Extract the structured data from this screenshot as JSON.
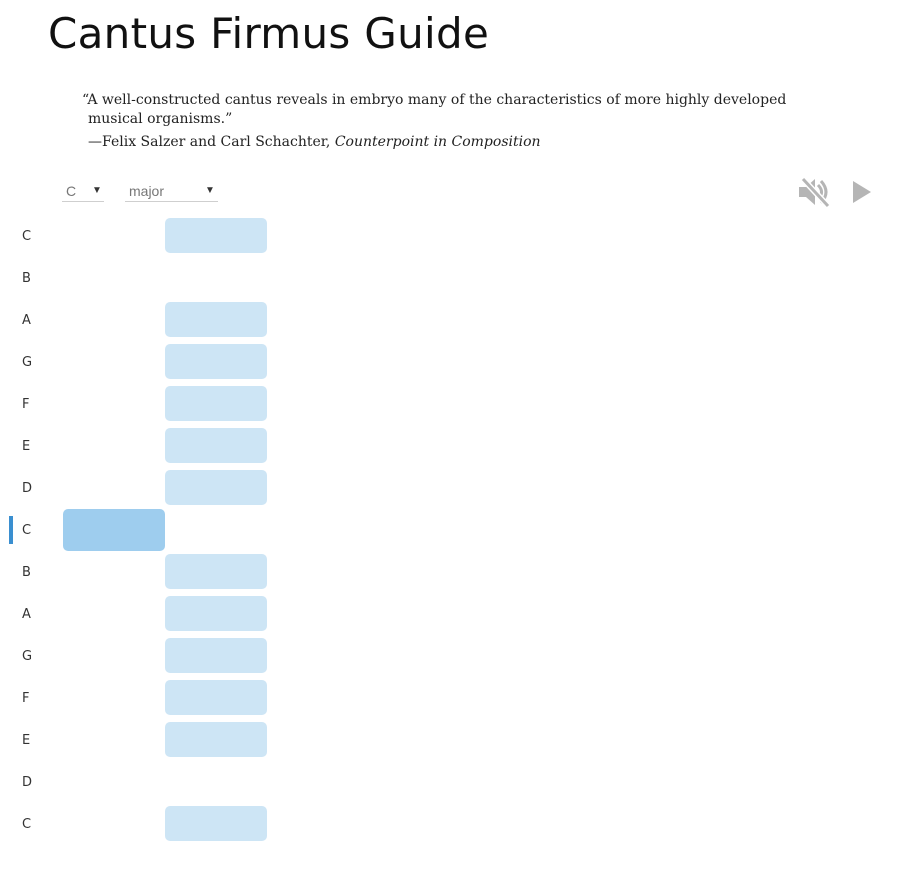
{
  "page": {
    "title": "Cantus Firmus Guide"
  },
  "quote": {
    "text": "“A well-constructed cantus reveals in embryo many of the characteristics of more highly developed musical organisms.”",
    "attribution_prefix": "—Felix Salzer and Carl Schachter, ",
    "attribution_work": "Counterpoint in Composition"
  },
  "controls": {
    "tonic": {
      "value": "C",
      "arrow": "▼"
    },
    "mode": {
      "value": "major",
      "arrow": "▼"
    },
    "mute_icon": "speaker-muted-icon",
    "play_icon": "play-icon",
    "icon_color": "#b5b5b5"
  },
  "colors": {
    "option_cell": "#cde5f5",
    "chosen_cell": "#9ecdee",
    "tonic_marker": "#3a8fd0"
  },
  "pitches": [
    {
      "label": "C",
      "option": true
    },
    {
      "label": "B",
      "option": false
    },
    {
      "label": "A",
      "option": true
    },
    {
      "label": "G",
      "option": true
    },
    {
      "label": "F",
      "option": true
    },
    {
      "label": "E",
      "option": true
    },
    {
      "label": "D",
      "option": true
    },
    {
      "label": "C",
      "option": false,
      "tonic": true,
      "chosen": true
    },
    {
      "label": "B",
      "option": true
    },
    {
      "label": "A",
      "option": true
    },
    {
      "label": "G",
      "option": true
    },
    {
      "label": "F",
      "option": true
    },
    {
      "label": "E",
      "option": true
    },
    {
      "label": "D",
      "option": false
    },
    {
      "label": "C",
      "option": true
    }
  ]
}
